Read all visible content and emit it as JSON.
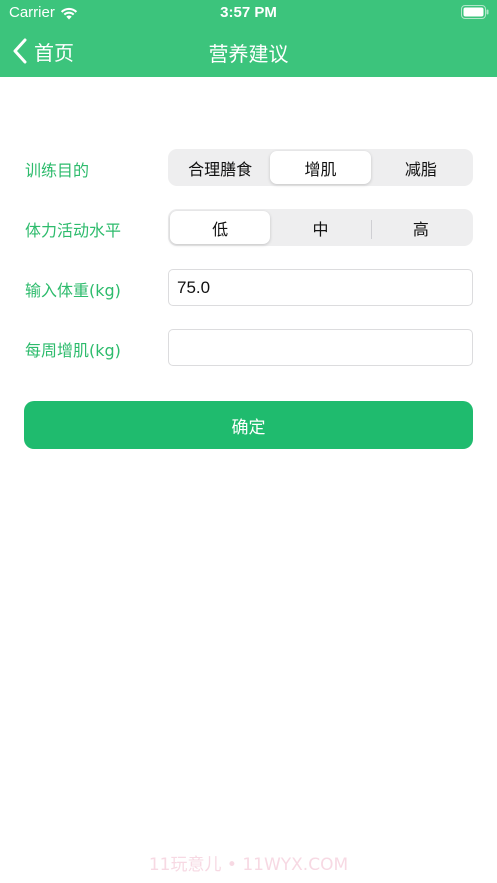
{
  "status_bar": {
    "carrier": "Carrier",
    "time": "3:57 PM"
  },
  "nav": {
    "back_label": "首页",
    "title": "营养建议"
  },
  "form": {
    "goal": {
      "label": "训练目的",
      "options": [
        "合理膳食",
        "增肌",
        "减脂"
      ],
      "selected": "增肌"
    },
    "activity": {
      "label": "体力活动水平",
      "options": [
        "低",
        "中",
        "高"
      ],
      "selected": "低"
    },
    "weight": {
      "label": "输入体重(kg)",
      "value": "75.0"
    },
    "weekly_gain": {
      "label": "每周增肌(kg)",
      "value": ""
    },
    "confirm_label": "确定"
  },
  "watermark": "11玩意儿 • 11WYX.COM",
  "colors": {
    "header": "#3cc47c",
    "label": "#2dbb6c",
    "button": "#1fbb6e"
  }
}
